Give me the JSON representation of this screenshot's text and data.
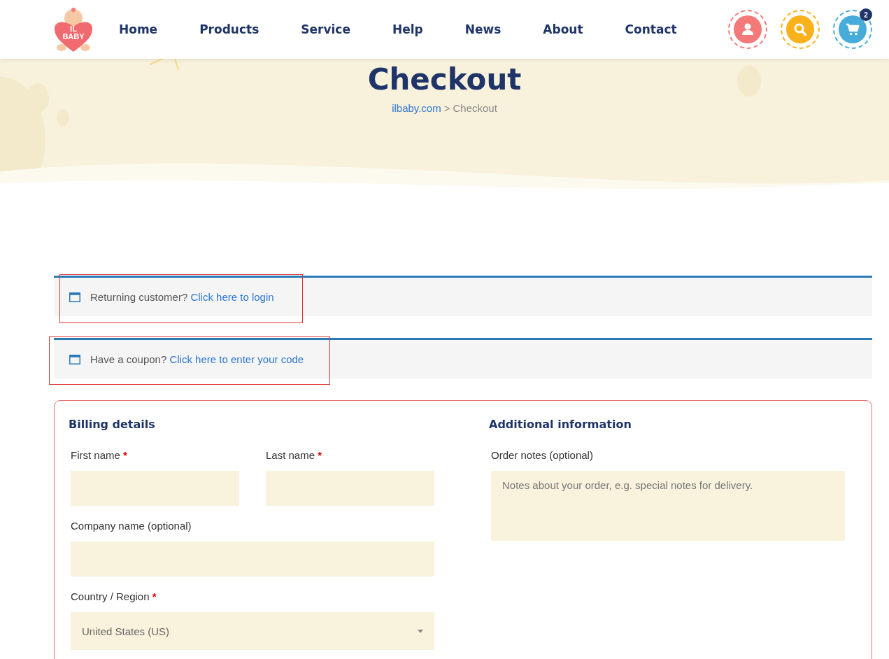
{
  "logo": {
    "line_1": "IL",
    "line_2": "BABY"
  },
  "nav": [
    {
      "label": "Home"
    },
    {
      "label": "Products"
    },
    {
      "label": "Service"
    },
    {
      "label": "Help"
    },
    {
      "label": "News"
    },
    {
      "label": "About"
    },
    {
      "label": "Contact"
    }
  ],
  "header_icons": [
    {
      "kind": "account",
      "color": "#f47a7a"
    },
    {
      "kind": "search",
      "color": "#f9b21c"
    },
    {
      "kind": "cart",
      "color": "#47acd9",
      "badge": "2"
    }
  ],
  "hero": {
    "title": "Checkout",
    "breadcrumb": [
      {
        "label": "ilbaby.com",
        "kind": "link"
      },
      {
        "label": ">",
        "kind": "separator"
      },
      {
        "label": "Checkout",
        "kind": "current"
      }
    ]
  },
  "notices": [
    {
      "text": "Returning customer?",
      "link": "Click here to login",
      "highlighted": true
    },
    {
      "text": "Have a coupon?",
      "link": "Click here to enter your code",
      "highlighted": true
    }
  ],
  "billing": {
    "title": "Billing details",
    "rows": [
      [
        {
          "label": "First name",
          "required_mark": "*",
          "kind": "text"
        },
        {
          "label": "Last name",
          "required_mark": "*",
          "kind": "text"
        }
      ],
      [
        {
          "label": "Company name (optional)",
          "kind": "text"
        }
      ],
      [
        {
          "label": "Country / Region",
          "required_mark": "*",
          "kind": "select",
          "value": "United States (US)"
        }
      ]
    ]
  },
  "additional": {
    "title": "Additional information",
    "notes_label": "Order notes (optional)",
    "notes_placeholder": "Notes about your order, e.g. special notes for delivery."
  }
}
